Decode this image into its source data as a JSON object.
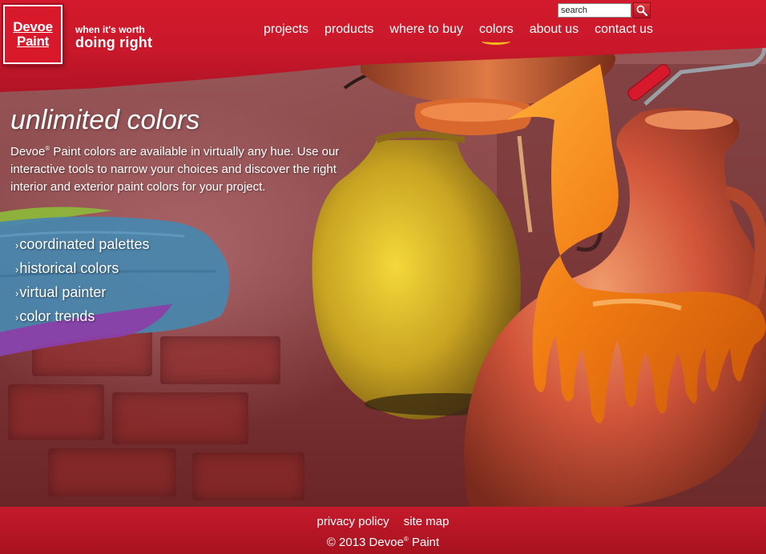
{
  "header": {
    "logo_line1": "Devoe",
    "logo_line2": "Paint",
    "tagline_small": "when it's worth",
    "tagline_large": "doing right"
  },
  "nav": {
    "items": [
      {
        "label": "projects"
      },
      {
        "label": "products"
      },
      {
        "label": "where to buy"
      },
      {
        "label": "colors",
        "active": true
      },
      {
        "label": "about us"
      },
      {
        "label": "contact us"
      }
    ]
  },
  "search": {
    "value": "search",
    "button_icon": "magnifier-icon"
  },
  "intro": {
    "title": "unlimited colors",
    "brand": "Devoe",
    "registered": "®",
    "text": " Paint colors are available in virtually any hue. Use our interactive tools to narrow your choices and discover the right interior and exterior paint colors for your project."
  },
  "color_menu": {
    "arrow": "›",
    "items": [
      {
        "label": "coordinated palettes"
      },
      {
        "label": "historical colors"
      },
      {
        "label": "virtual painter"
      },
      {
        "label": "color trends"
      }
    ]
  },
  "footer": {
    "links": [
      {
        "label": "privacy policy"
      },
      {
        "label": "site map"
      }
    ],
    "copyright_prefix": "© 2013 Devoe",
    "copyright_reg": "®",
    "copyright_suffix": " Paint"
  },
  "colors": {
    "brand_red": "#d31a2c",
    "accent_yellow": "#f4b81c",
    "swatch_blue": "#4a86ad",
    "swatch_purple": "#8a3fa8",
    "swatch_green": "#8dbb3a",
    "paint_orange": "#f07a12",
    "pot_yellow": "#c9a422"
  }
}
